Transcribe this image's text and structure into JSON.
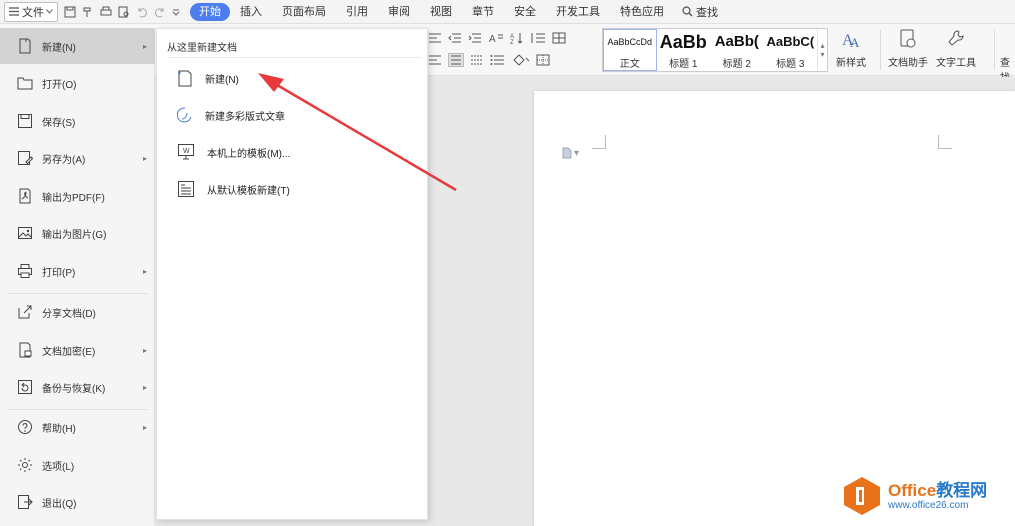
{
  "tabbar": {
    "file_label": "文件",
    "tabs": [
      "开始",
      "插入",
      "页面布局",
      "引用",
      "审阅",
      "视图",
      "章节",
      "安全",
      "开发工具",
      "特色应用"
    ],
    "active_tab": "开始",
    "search_label": "查找"
  },
  "ribbon": {
    "styles": [
      {
        "sample": "AaBbCcDd",
        "name": "正文"
      },
      {
        "sample": "AaBb",
        "name": "标题 1"
      },
      {
        "sample": "AaBb(",
        "name": "标题 2"
      },
      {
        "sample": "AaBbC(",
        "name": "标题 3"
      }
    ],
    "new_style_label": "新样式",
    "doc_assistant_label": "文档助手",
    "text_tools_label": "文字工具",
    "cut_label": "查找"
  },
  "file_menu": {
    "items": [
      {
        "label": "新建(N)",
        "icon": "new-doc-icon",
        "has_submenu": true
      },
      {
        "label": "打开(O)",
        "icon": "folder-open-icon",
        "has_submenu": false
      },
      {
        "label": "保存(S)",
        "icon": "save-icon",
        "has_submenu": false
      },
      {
        "label": "另存为(A)",
        "icon": "save-as-icon",
        "has_submenu": true
      },
      {
        "label": "输出为PDF(F)",
        "icon": "pdf-export-icon",
        "has_submenu": false
      },
      {
        "label": "输出为图片(G)",
        "icon": "image-export-icon",
        "has_submenu": false
      },
      {
        "label": "打印(P)",
        "icon": "print-icon",
        "has_submenu": true
      },
      {
        "label": "分享文档(D)",
        "icon": "share-icon",
        "has_submenu": false
      },
      {
        "label": "文档加密(E)",
        "icon": "encrypt-icon",
        "has_submenu": true
      },
      {
        "label": "备份与恢复(K)",
        "icon": "backup-icon",
        "has_submenu": true
      },
      {
        "label": "帮助(H)",
        "icon": "help-icon",
        "has_submenu": true
      },
      {
        "label": "选项(L)",
        "icon": "gear-icon",
        "has_submenu": false
      },
      {
        "label": "退出(Q)",
        "icon": "exit-icon",
        "has_submenu": false
      }
    ]
  },
  "submenu": {
    "title": "从这里新建文档",
    "items": [
      {
        "label": "新建(N)",
        "icon": "blank-doc-icon"
      },
      {
        "label": "新建多彩版式文章",
        "icon": "colorful-layout-icon"
      },
      {
        "label": "本机上的模板(M)...",
        "icon": "local-template-icon"
      },
      {
        "label": "从默认模板新建(T)",
        "icon": "default-template-icon"
      }
    ]
  },
  "watermark": {
    "brand_part1": "Office",
    "brand_part2": "教程网",
    "url": "www.office26.com"
  },
  "colors": {
    "accent": "#4c7ef0",
    "annotation_arrow": "#e8393c",
    "brand_orange": "#e8721c",
    "brand_blue": "#2a7ac8"
  }
}
